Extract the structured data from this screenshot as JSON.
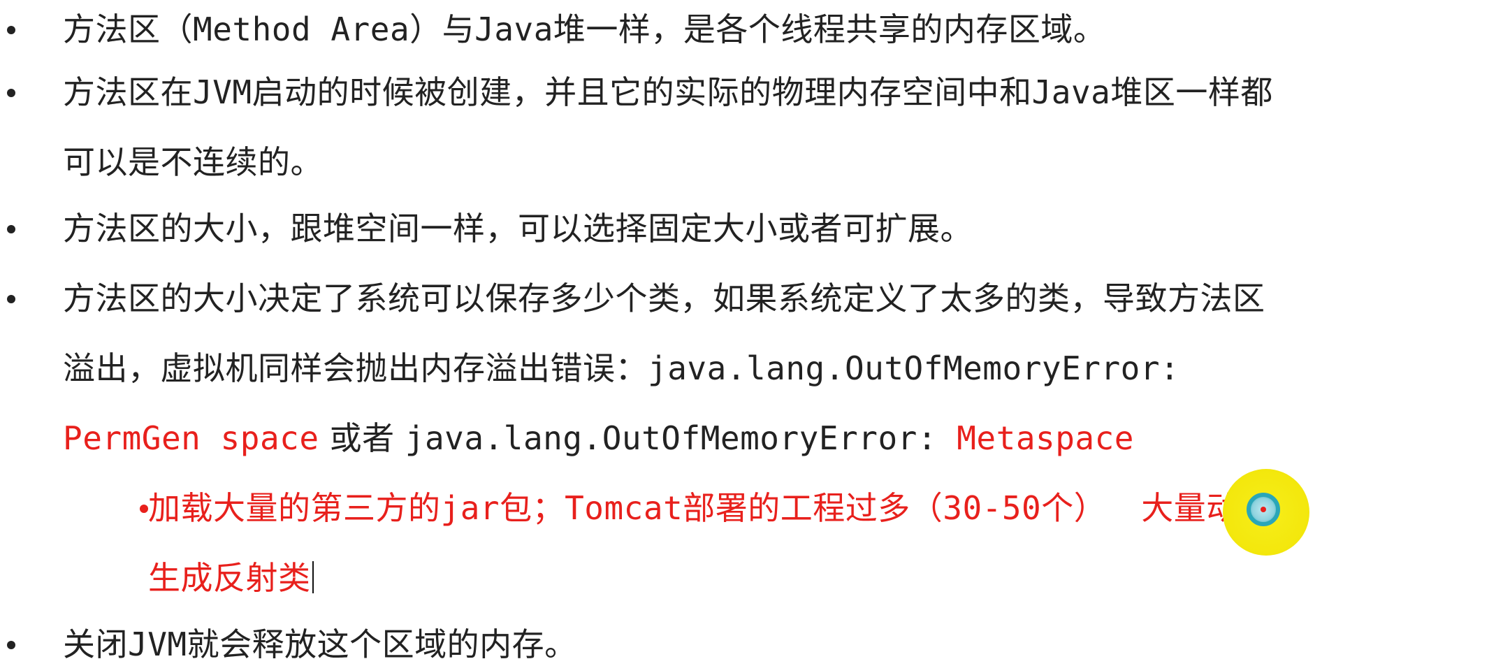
{
  "colors": {
    "text": "#222222",
    "emphasis_red": "#e8201c",
    "pointer_yellow": "#f3e70c",
    "pointer_ring": "#2aa6b8"
  },
  "bullets": [
    {
      "line1_a": "方法区（",
      "line1_code": "Method Area",
      "line1_b": "）与",
      "line1_java": "Java",
      "line1_c": "堆一样，是各个线程共享的内存区域。"
    },
    {
      "line1_a": "方法区在",
      "line1_jvm": "JVM",
      "line1_b": "启动的时候被创建，并且它的实际的物理内存空间中和",
      "line1_java": "Java",
      "line1_c": "堆区一样都",
      "line2": "可以是不连续的。"
    },
    {
      "line1": "方法区的大小，跟堆空间一样，可以选择固定大小或者可扩展。"
    },
    {
      "line1": "方法区的大小决定了系统可以保存多少个类，如果系统定义了太多的类，导致方法区",
      "line2_a": "溢出，虚拟机同样会抛出内存溢出错误：",
      "line2_code": "java.lang.OutOfMemoryError:",
      "line3_red1": "PermGen space",
      "line3_mid": " 或者 ",
      "line3_code": "java.lang.OutOfMemoryError: ",
      "line3_red2": "Metaspace",
      "sub": {
        "line1_a": "加载大量的第三方的",
        "line1_jar": "jar",
        "line1_b": "包；",
        "line1_tomcat": "Tomcat",
        "line1_c": "部署的工程过多（",
        "line1_num": "30-50",
        "line1_d": "个）",
        "line1_e": "大量动态的",
        "line2": "生成反射类"
      }
    },
    {
      "line1_a": "关闭",
      "line1_jvm": "JVM",
      "line1_b": "就会释放这个区域的内存。"
    }
  ],
  "icons": {
    "bullet": "bullet-dot-icon",
    "pointer": "cursor-highlight-icon"
  }
}
